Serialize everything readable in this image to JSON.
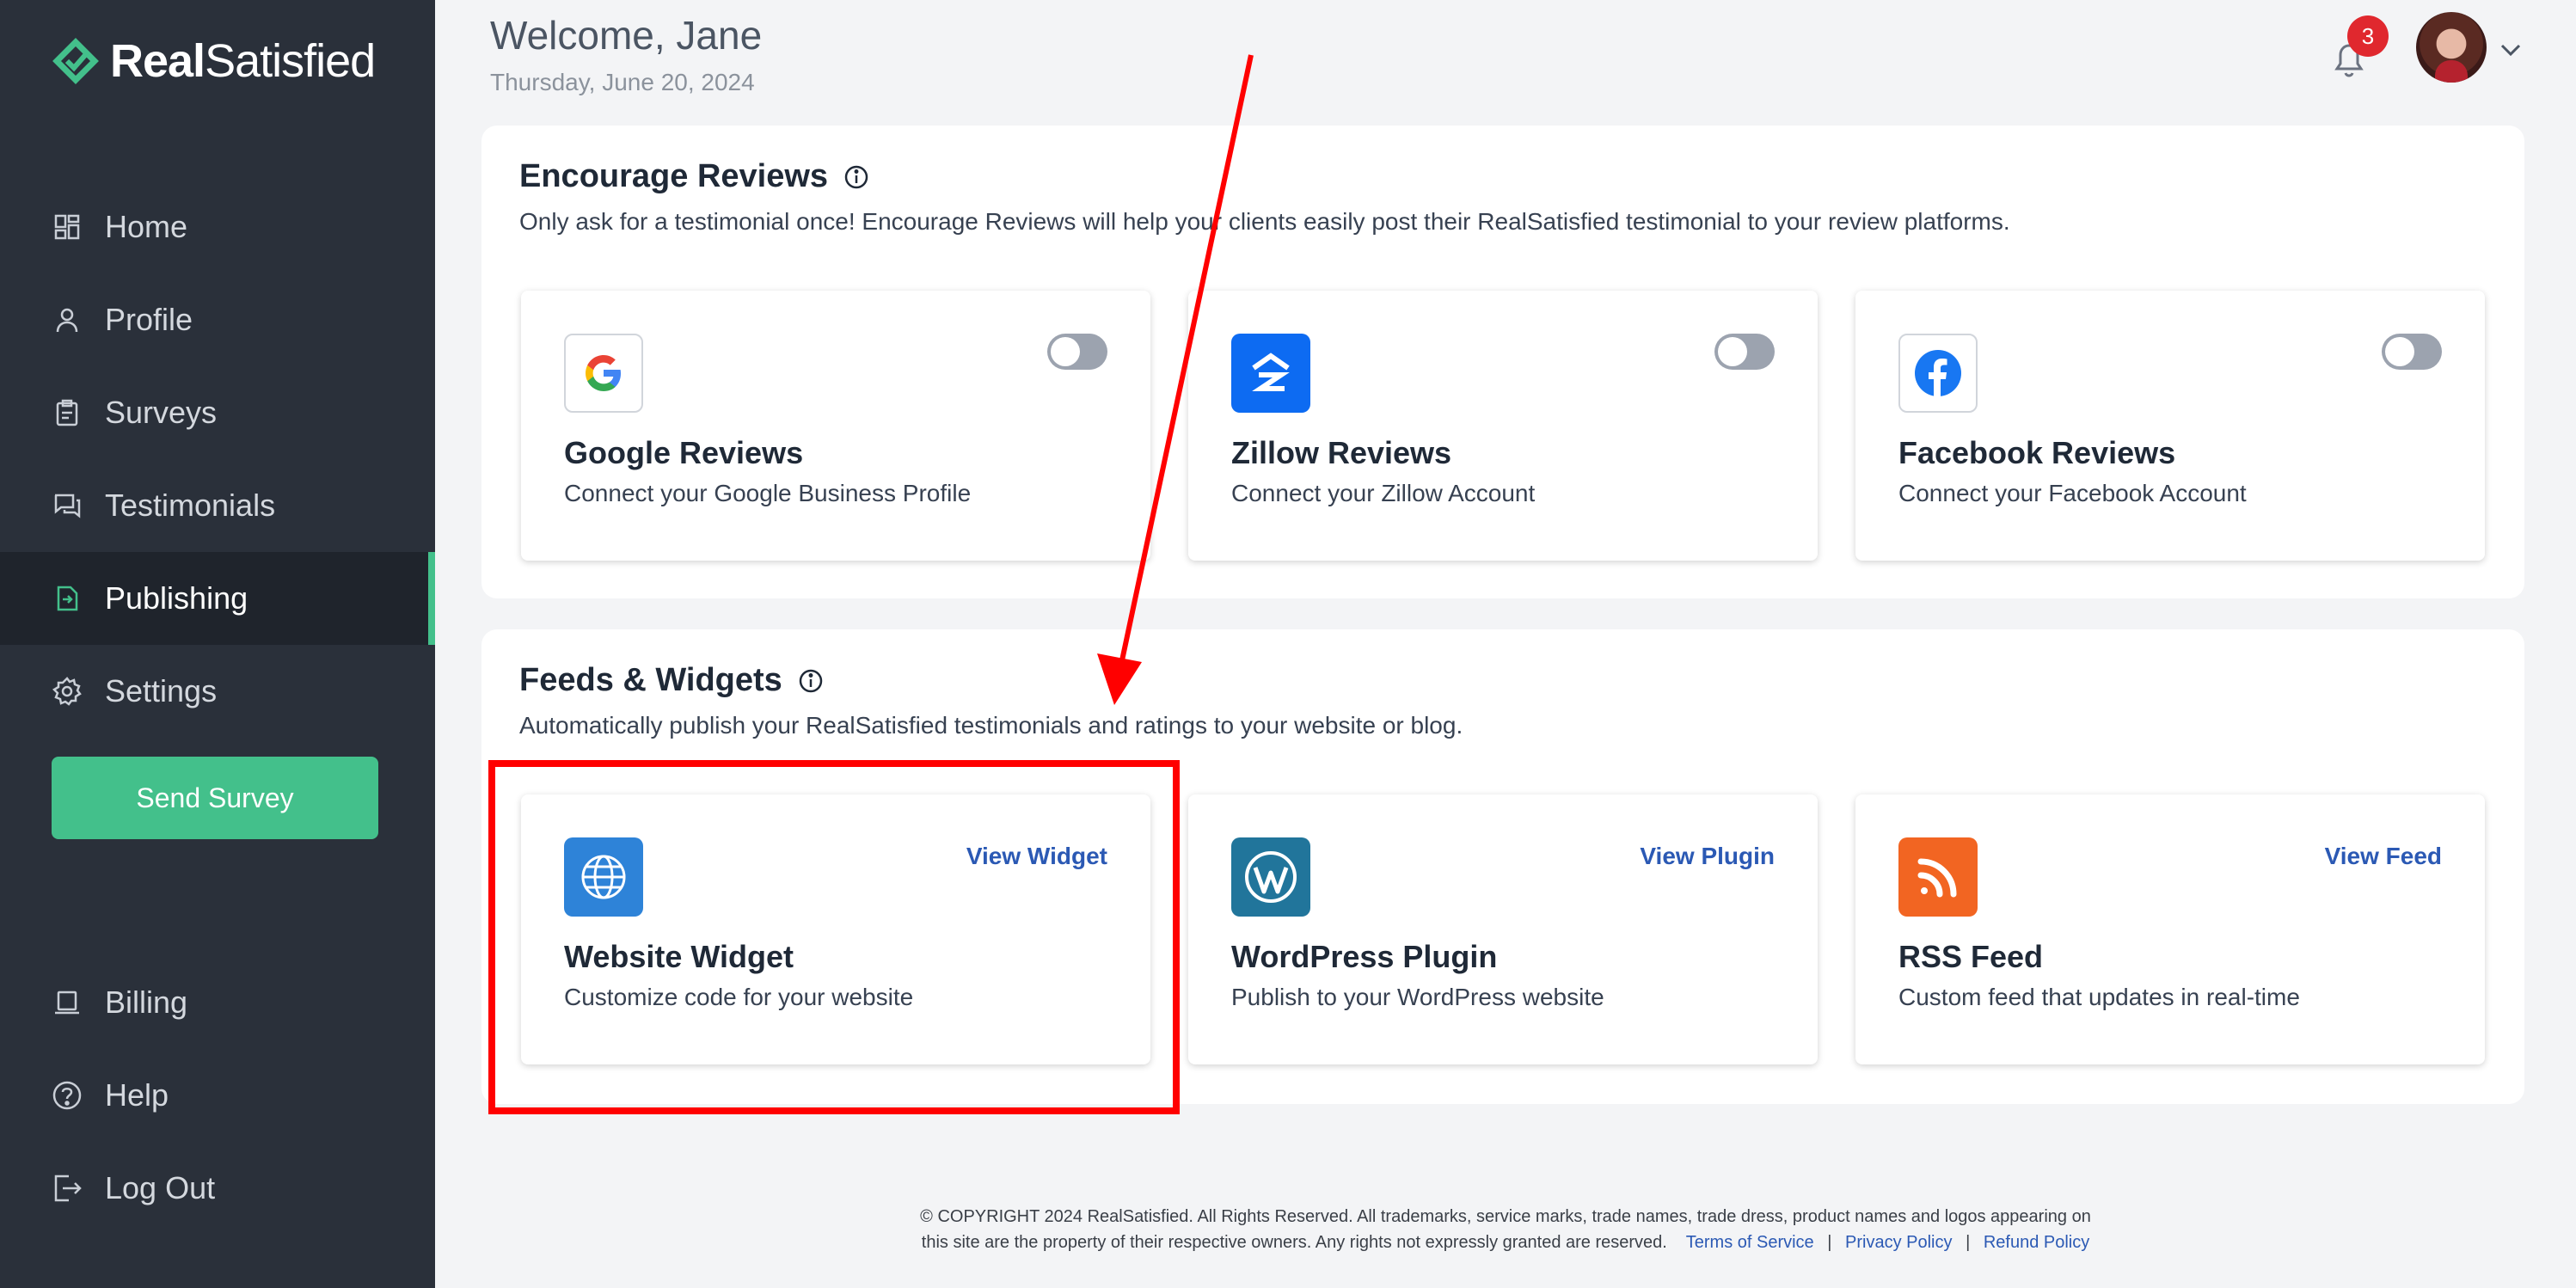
{
  "app": {
    "logo_bold": "Real",
    "logo_light": "Satisfied",
    "brand_color": "#43c08b"
  },
  "sidebar": {
    "items": [
      {
        "label": "Home",
        "icon": "dashboard-icon"
      },
      {
        "label": "Profile",
        "icon": "user-icon"
      },
      {
        "label": "Surveys",
        "icon": "clipboard-icon"
      },
      {
        "label": "Testimonials",
        "icon": "chat-icon"
      },
      {
        "label": "Publishing",
        "icon": "publish-icon",
        "active": true
      },
      {
        "label": "Settings",
        "icon": "gear-icon"
      }
    ],
    "send_button": "Send Survey",
    "bottom_items": [
      {
        "label": "Billing",
        "icon": "laptop-icon"
      },
      {
        "label": "Help",
        "icon": "help-circle-icon"
      },
      {
        "label": "Log Out",
        "icon": "logout-icon"
      }
    ]
  },
  "header": {
    "welcome": "Welcome, Jane",
    "date": "Thursday, June 20, 2024",
    "notification_count": "3"
  },
  "encourage": {
    "title": "Encourage Reviews",
    "description": "Only ask for a testimonial once! Encourage Reviews will help your clients easily post their RealSatisfied testimonial to your review platforms.",
    "cards": [
      {
        "title": "Google Reviews",
        "desc": "Connect your Google Business Profile",
        "icon": "google-icon",
        "enabled": false
      },
      {
        "title": "Zillow Reviews",
        "desc": "Connect your Zillow Account",
        "icon": "zillow-icon",
        "enabled": false
      },
      {
        "title": "Facebook Reviews",
        "desc": "Connect your Facebook Account",
        "icon": "facebook-icon",
        "enabled": false
      }
    ]
  },
  "feeds": {
    "title": "Feeds & Widgets",
    "description": "Automatically publish your RealSatisfied testimonials and ratings to your website or blog.",
    "cards": [
      {
        "title": "Website Widget",
        "desc": "Customize code for your website",
        "link": "View Widget",
        "icon": "globe-icon"
      },
      {
        "title": "WordPress Plugin",
        "desc": "Publish to your WordPress website",
        "link": "View Plugin",
        "icon": "wordpress-icon"
      },
      {
        "title": "RSS Feed",
        "desc": "Custom feed that updates in real-time",
        "link": "View Feed",
        "icon": "rss-icon"
      }
    ]
  },
  "footer": {
    "line1": "© COPYRIGHT 2024 RealSatisfied. All Rights Reserved. All trademarks, service marks, trade names, trade dress, product names and logos appearing on",
    "line2": "this site are the property of their respective owners. Any rights not expressly granted are reserved.",
    "links": [
      "Terms of Service",
      "Privacy Policy",
      "Refund Policy"
    ],
    "separator": "|"
  }
}
